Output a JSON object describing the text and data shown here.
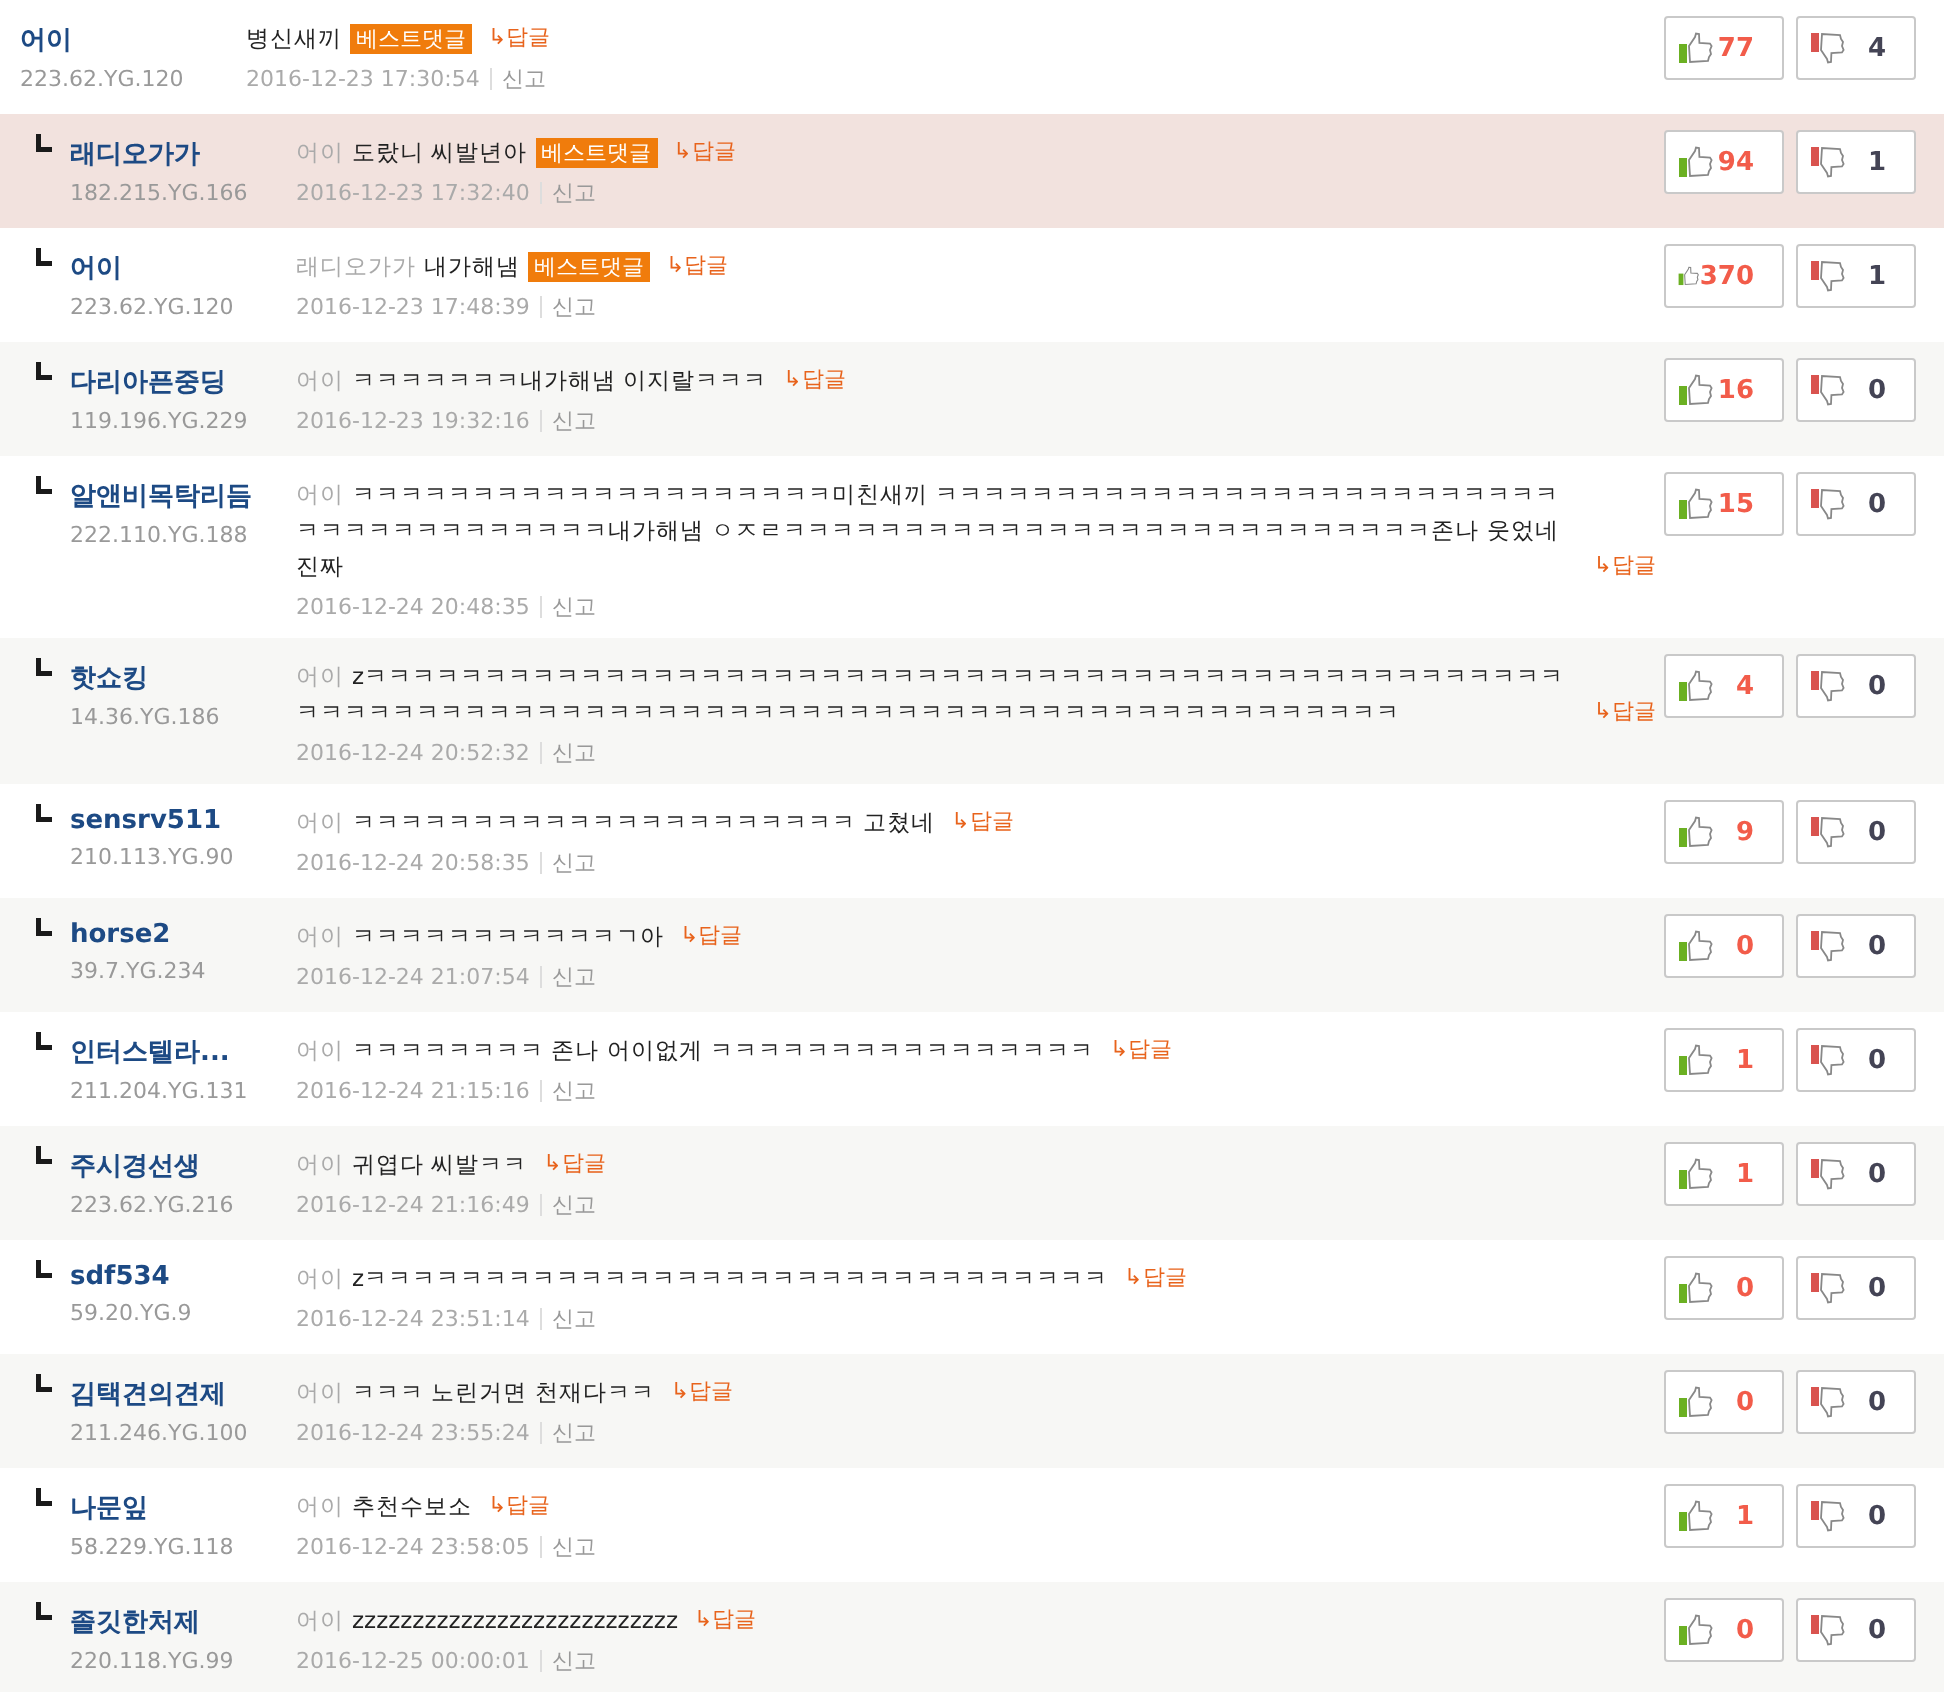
{
  "comments": [
    {
      "name": "어이",
      "ip": "223.62.YG.120",
      "reply": false,
      "highlighted": false,
      "text": "병신새끼",
      "best": true,
      "best_label": "베스트댓글",
      "reply_link": "↳답글",
      "time": "2016-12-23 17:30:54",
      "report": "신고",
      "likes": "77",
      "dislikes": "4"
    },
    {
      "name": "래디오가가",
      "ip": "182.215.YG.166",
      "reply": true,
      "highlighted": true,
      "mention": "어이",
      "text": "도랐니 씨발년아",
      "best": true,
      "best_label": "베스트댓글",
      "reply_link": "↳답글",
      "time": "2016-12-23 17:32:40",
      "report": "신고",
      "likes": "94",
      "dislikes": "1"
    },
    {
      "name": "어이",
      "ip": "223.62.YG.120",
      "reply": true,
      "highlighted": false,
      "mention": "래디오가가",
      "text": "내가해냄",
      "best": true,
      "best_label": "베스트댓글",
      "reply_link": "↳답글",
      "time": "2016-12-23 17:48:39",
      "report": "신고",
      "likes": "370",
      "dislikes": "1"
    },
    {
      "name": "다리아픈중딩",
      "ip": "119.196.YG.229",
      "reply": true,
      "highlighted": false,
      "mention": "어이",
      "text": "ㅋㅋㅋㅋㅋㅋㅋ내가해냄 이지랄ㅋㅋㅋ",
      "best": false,
      "reply_link": "↳답글",
      "time": "2016-12-23 19:32:16",
      "report": "신고",
      "likes": "16",
      "dislikes": "0"
    },
    {
      "name": "알앤비목탁리듬",
      "ip": "222.110.YG.188",
      "reply": true,
      "highlighted": false,
      "mention": "어이",
      "text": "ㅋㅋㅋㅋㅋㅋㅋㅋㅋㅋㅋㅋㅋㅋㅋㅋㅋㅋㅋㅋ미친새끼 ㅋㅋㅋㅋㅋㅋㅋㅋㅋㅋㅋㅋㅋㅋㅋㅋㅋㅋㅋㅋㅋㅋㅋㅋㅋㅋㅋㅋㅋㅋㅋㅋㅋㅋㅋㅋㅋㅋㅋ내가해냄 ㅇㅈㄹㅋㅋㅋㅋㅋㅋㅋㅋㅋㅋㅋㅋㅋㅋㅋㅋㅋㅋㅋㅋㅋㅋㅋㅋㅋㅋㅋ존나 웃었네 진짜",
      "best": false,
      "reply_link": "↳답글",
      "time": "2016-12-24 20:48:35",
      "report": "신고",
      "likes": "15",
      "dislikes": "0"
    },
    {
      "name": "핫쇼킹",
      "ip": "14.36.YG.186",
      "reply": true,
      "highlighted": false,
      "mention": "어이",
      "text": "zㅋㅋㅋㅋㅋㅋㅋㅋㅋㅋㅋㅋㅋㅋㅋㅋㅋㅋㅋㅋㅋㅋㅋㅋㅋㅋㅋㅋㅋㅋㅋㅋㅋㅋㅋㅋㅋㅋㅋㅋㅋㅋㅋㅋㅋㅋㅋㅋㅋㅋㅋㅋㅋㅋㅋㅋㅋㅋㅋㅋㅋㅋㅋㅋㅋㅋㅋㅋㅋㅋㅋㅋㅋㅋㅋㅋㅋㅋㅋㅋㅋㅋㅋㅋㅋㅋㅋㅋㅋㅋㅋㅋㅋㅋㅋㅋ",
      "best": false,
      "reply_link": "↳답글",
      "time": "2016-12-24 20:52:32",
      "report": "신고",
      "likes": "4",
      "dislikes": "0"
    },
    {
      "name": "sensrv511",
      "ip": "210.113.YG.90",
      "reply": true,
      "highlighted": false,
      "mention": "어이",
      "text": "ㅋㅋㅋㅋㅋㅋㅋㅋㅋㅋㅋㅋㅋㅋㅋㅋㅋㅋㅋㅋㅋ 고쳤네",
      "best": false,
      "reply_link": "↳답글",
      "time": "2016-12-24 20:58:35",
      "report": "신고",
      "likes": "9",
      "dislikes": "0"
    },
    {
      "name": "horse2",
      "ip": "39.7.YG.234",
      "reply": true,
      "highlighted": false,
      "mention": "어이",
      "text": "ㅋㅋㅋㅋㅋㅋㅋㅋㅋㅋㅋㄱ아",
      "best": false,
      "reply_link": "↳답글",
      "time": "2016-12-24 21:07:54",
      "report": "신고",
      "likes": "0",
      "dislikes": "0"
    },
    {
      "name": "인터스텔라...",
      "ip": "211.204.YG.131",
      "reply": true,
      "highlighted": false,
      "mention": "어이",
      "text": "ㅋㅋㅋㅋㅋㅋㅋㅋ 존나 어이없게 ㅋㅋㅋㅋㅋㅋㅋㅋㅋㅋㅋㅋㅋㅋㅋㅋ",
      "best": false,
      "reply_link": "↳답글",
      "time": "2016-12-24 21:15:16",
      "report": "신고",
      "likes": "1",
      "dislikes": "0"
    },
    {
      "name": "주시경선생",
      "ip": "223.62.YG.216",
      "reply": true,
      "highlighted": false,
      "mention": "어이",
      "text": "귀엽다 씨발ㅋㅋ",
      "best": false,
      "reply_link": "↳답글",
      "time": "2016-12-24 21:16:49",
      "report": "신고",
      "likes": "1",
      "dislikes": "0"
    },
    {
      "name": "sdf534",
      "ip": "59.20.YG.9",
      "reply": true,
      "highlighted": false,
      "mention": "어이",
      "text": "zㅋㅋㅋㅋㅋㅋㅋㅋㅋㅋㅋㅋㅋㅋㅋㅋㅋㅋㅋㅋㅋㅋㅋㅋㅋㅋㅋㅋㅋㅋㅋ",
      "best": false,
      "reply_link": "↳답글",
      "time": "2016-12-24 23:51:14",
      "report": "신고",
      "likes": "0",
      "dislikes": "0"
    },
    {
      "name": "김택견의견제",
      "ip": "211.246.YG.100",
      "reply": true,
      "highlighted": false,
      "mention": "어이",
      "text": "ㅋㅋㅋ 노린거면 천재다ㅋㅋ",
      "best": false,
      "reply_link": "↳답글",
      "time": "2016-12-24 23:55:24",
      "report": "신고",
      "likes": "0",
      "dislikes": "0"
    },
    {
      "name": "나문잎",
      "ip": "58.229.YG.118",
      "reply": true,
      "highlighted": false,
      "mention": "어이",
      "text": "추천수보소",
      "best": false,
      "reply_link": "↳답글",
      "time": "2016-12-24 23:58:05",
      "report": "신고",
      "likes": "1",
      "dislikes": "0"
    },
    {
      "name": "졸깃한처제",
      "ip": "220.118.YG.99",
      "reply": true,
      "highlighted": false,
      "mention": "어이",
      "text": "zzzzzzzzzzzzzzzzzzzzzzzzzzz",
      "best": false,
      "reply_link": "↳답글",
      "time": "2016-12-25 00:00:01",
      "report": "신고",
      "likes": "0",
      "dislikes": "0"
    }
  ]
}
